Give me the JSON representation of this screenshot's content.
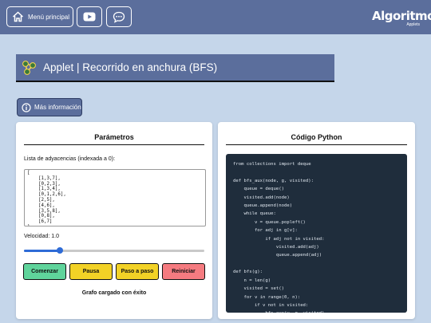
{
  "topbar": {
    "menu_label": "Menú principal",
    "menu_icon": "home-icon",
    "youtube_icon": "youtube-icon",
    "chat_icon": "chat-icon"
  },
  "logo": {
    "word": "Algoritmos",
    "sub": "Applets"
  },
  "page": {
    "title": "Applet | Recorrido en anchura (BFS)",
    "title_icon": "graph-icon"
  },
  "info_button": {
    "label": "Más información",
    "icon": "info-icon"
  },
  "params": {
    "title": "Parámetros",
    "adjacency_label": "Lista de adyacencias (indexada a 0):",
    "adjacency_value": "[\n    [1,3,7],\n    [0,2,3],\n    [1,3,4],\n    [0,1,2,6],\n    [2,5],\n    [4,6],\n    [3,5,8],\n    [0,8],\n    [6,7]\n]",
    "speed_label": "Velocidad: 1.0",
    "speed_fraction": 0.2,
    "buttons": {
      "start": "Comenzar",
      "pause": "Pausa",
      "step": "Paso a paso",
      "reset": "Reiniciar"
    },
    "status": "Grafo cargado con éxito"
  },
  "code": {
    "title": "Código Python",
    "lines": [
      "from collections import deque",
      "",
      "def bfs_aux(node, g, visited):",
      "    queue = deque()",
      "    visited.add(node)",
      "    queue.append(node)",
      "    while queue:",
      "        v = queue.popleft()",
      "        for adj in g[v]:",
      "            if adj not in visited:",
      "                visited.add(adj)",
      "                queue.append(adj)",
      "",
      "def bfs(g):",
      "    n = len(g)",
      "    visited = set()",
      "    for v in range(0, n):",
      "        if v not in visited:",
      "            bfs_aux(v, g, visited)"
    ]
  },
  "colors": {
    "background": "#c5d6ea",
    "topbar": "#5b6e9c",
    "start": "#5fd49b",
    "pause": "#f2d226",
    "reset": "#f57b80",
    "code_bg": "#1f2d3c",
    "slider": "#2e6bd6"
  }
}
